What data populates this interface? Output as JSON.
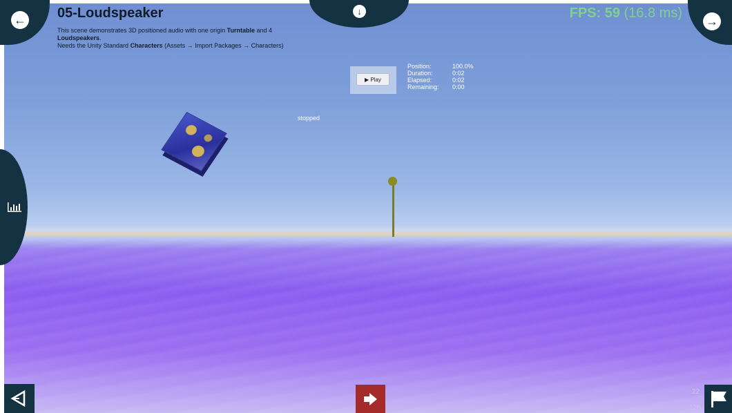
{
  "header": {
    "title": "05-Loudspeaker",
    "desc_line1_a": "This scene demonstrates 3D positioned audio with one origin ",
    "desc_line1_b": "Turntable",
    "desc_line1_c": " and 4",
    "desc_line2_a": "Loudspeakers",
    "desc_line2_b": ".",
    "desc_line3_a": "Needs the Unity Standard ",
    "desc_line3_b": "Characters",
    "desc_line3_c": " (Assets → Import Packages → Characters)"
  },
  "fps": {
    "label": "FPS: 59",
    "ms": " (16.8 ms)"
  },
  "player": {
    "play_label": "▶ Play",
    "status": "stopped"
  },
  "stats": [
    {
      "label": "Position:",
      "value": "100.0%"
    },
    {
      "label": "Duration:",
      "value": "0:02"
    },
    {
      "label": "Elapsed:",
      "value": "0:02"
    },
    {
      "label": "Remaining:",
      "value": "0:00"
    }
  ],
  "corner_numbers": {
    "top": "22",
    "bottom": "126"
  },
  "icons": {
    "prev": "arrow-left-circle-icon",
    "next": "arrow-right-circle-icon",
    "download": "arrow-down-circle-icon",
    "stats": "bar-chart-icon",
    "unity": "unity-logo-icon",
    "exit": "exit-arrow-icon",
    "flag": "flag-icon"
  },
  "colors": {
    "panel": "#143241",
    "fps": "#7fd28c",
    "exit": "#a52b2b",
    "floor": "#8a5bf0",
    "sky": "#7fa0da"
  }
}
